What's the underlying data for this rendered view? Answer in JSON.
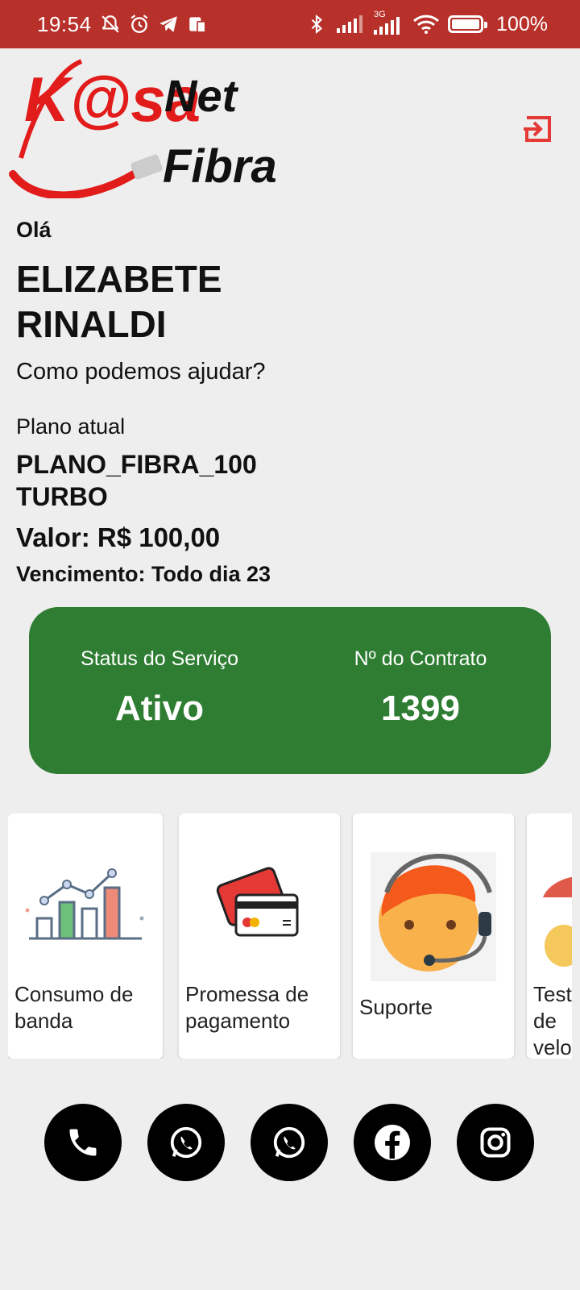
{
  "status_bar": {
    "time": "19:54",
    "network": "3G",
    "battery": "100%",
    "icons": [
      "muted-alarm-icon",
      "alarm-icon",
      "telegram-icon",
      "sim-icon",
      "bluetooth-icon",
      "signal-icon",
      "signal-3g-icon",
      "wifi-icon",
      "battery-icon"
    ]
  },
  "header": {
    "logo_text_1": "K@sa",
    "logo_text_2": "Net",
    "logo_text_3": "Fibra",
    "logout_icon": "logout-icon"
  },
  "greeting": {
    "hello": "Olá",
    "name": "ELIZABETE RINALDI",
    "question": "Como podemos ajudar?"
  },
  "plan": {
    "label": "Plano atual",
    "name": "PLANO_FIBRA_100 TURBO",
    "value": "Valor: R$ 100,00",
    "due": "Vencimento: Todo dia 23"
  },
  "service_status": {
    "status_label": "Status do Serviço",
    "status_value": "Ativo",
    "contract_label": "Nº do Contrato",
    "contract_value": "1399",
    "color": "#2e7d32"
  },
  "cards": [
    {
      "title": "Consumo de banda",
      "icon": "chart-icon"
    },
    {
      "title": "Promessa de pagamento",
      "icon": "credit-card-icon"
    },
    {
      "title": "Suporte",
      "icon": "support-agent-icon"
    },
    {
      "title": "Teste de velocidade",
      "icon": "speedometer-icon"
    }
  ],
  "social": [
    {
      "name": "phone",
      "icon": "phone-icon"
    },
    {
      "name": "whatsapp-1",
      "icon": "whatsapp-icon"
    },
    {
      "name": "whatsapp-2",
      "icon": "whatsapp-icon"
    },
    {
      "name": "facebook",
      "icon": "facebook-icon"
    },
    {
      "name": "instagram",
      "icon": "instagram-icon"
    }
  ],
  "colors": {
    "brand_red": "#b8302a",
    "accent_red": "#e53935",
    "status_green": "#2e7d32",
    "background": "#eeeeee"
  }
}
